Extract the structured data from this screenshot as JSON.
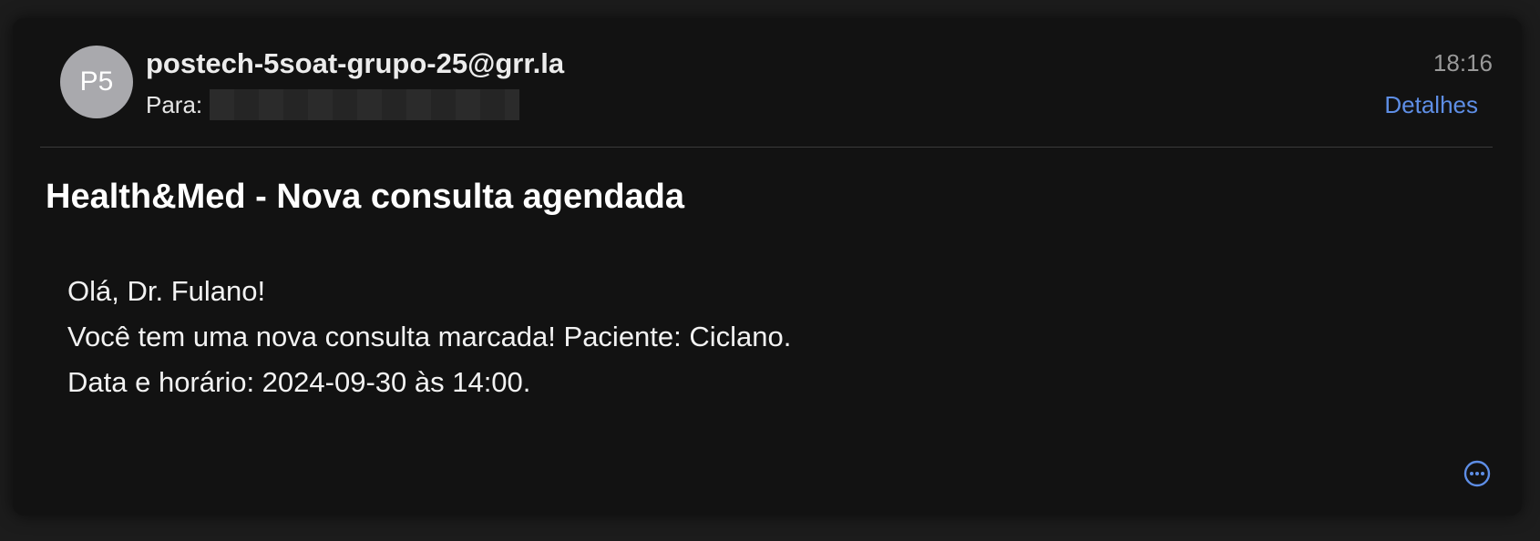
{
  "email": {
    "avatar_initials": "P5",
    "sender": "postech-5soat-grupo-25@grr.la",
    "recipient_label": "Para:",
    "time": "18:16",
    "details_label": "Detalhes",
    "subject": "Health&Med - Nova consulta agendada",
    "body_lines": [
      "Olá, Dr. Fulano!",
      "Você tem uma nova consulta marcada! Paciente: Ciclano.",
      "Data e horário: 2024-09-30 às 14:00."
    ]
  },
  "icons": {
    "more": "ellipsis-circle-icon"
  },
  "colors": {
    "background": "#1c1c1c",
    "card": "#121212",
    "accent": "#5e8ee6",
    "avatar": "#a9a9ad"
  }
}
